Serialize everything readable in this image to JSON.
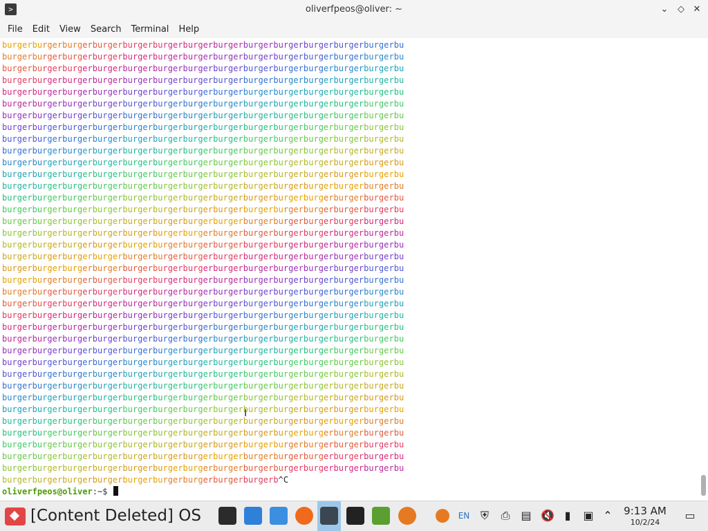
{
  "window": {
    "title": "oliverfpeos@oliver: ~",
    "app_icon": "terminal-app-icon",
    "controls": {
      "minimize": "chevron-down-icon",
      "maximize": "diamond-icon",
      "close": "close-icon"
    }
  },
  "menu": [
    "File",
    "Edit",
    "View",
    "Search",
    "Terminal",
    "Help"
  ],
  "terminal": {
    "colored_line_text": "burgerburgerburgerburgerburgerburgerburgerburgerburgerburgerburgerburgerburgerbu",
    "colored_line_count": 37,
    "partial_line": {
      "text": "burgerburgerburgerburgerburgerburgerburgerburgerburgerb",
      "interrupt": "^C"
    },
    "prompt": {
      "user_host": "oliverfpeos@oliver",
      "separator": ":",
      "path": "~",
      "symbol": "$ "
    },
    "palette": [
      "#e6a100",
      "#e07c28",
      "#e05a3e",
      "#e03a60",
      "#d2287e",
      "#b8289c",
      "#9630b8",
      "#7040c8",
      "#4e58d0",
      "#3470d0",
      "#2888c8",
      "#20a0b8",
      "#20b4a0",
      "#28c080",
      "#44c864",
      "#66c848",
      "#8ac438",
      "#b0b828",
      "#c8a820",
      "#d89818"
    ]
  },
  "taskbar": {
    "os_name": "[Content Deleted] OS",
    "apps": [
      "terminal-window-icon",
      "store-icon",
      "files-icon",
      "firefox-icon",
      "terminal-icon",
      "app-icon",
      "game-icon",
      "burger-icon"
    ],
    "tray": {
      "lang": "EN",
      "icons": [
        "burger-tray-icon",
        "shield-icon",
        "clipboard-icon",
        "notes-icon",
        "muted-speaker-icon",
        "battery-icon",
        "network-icon",
        "chevron-up-icon"
      ]
    },
    "clock": {
      "time": "9:13 AM",
      "date": "10/2/24"
    },
    "show_desktop": "show-desktop-icon"
  }
}
